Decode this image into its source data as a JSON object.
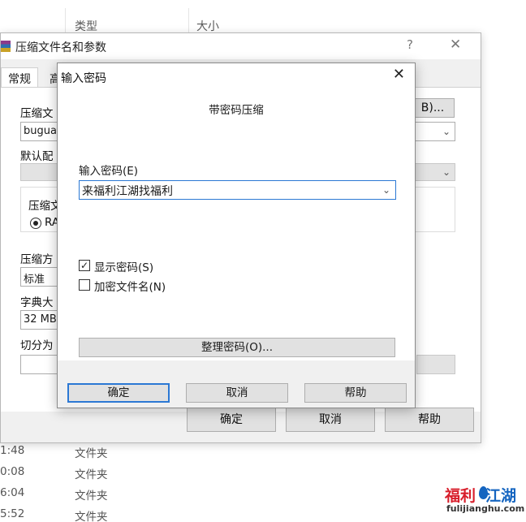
{
  "explorer": {
    "col_type": "类型",
    "col_size": "大小",
    "rows": [
      {
        "time": "1:48",
        "type": "文件夹"
      },
      {
        "time": "0:08",
        "type": "文件夹"
      },
      {
        "time": "6:04",
        "type": "文件夹"
      },
      {
        "time": "5:52",
        "type": "文件夹"
      }
    ]
  },
  "archive_dialog": {
    "title": "压缩文件名和参数",
    "help": "?",
    "close": "✕",
    "tab_general": "常规",
    "tab_advanced": "高",
    "label_archive_name": "压缩文",
    "browse_button": "B)...",
    "archive_name_value": "buguai",
    "label_default_profile": "默认配",
    "label_format": "压缩文",
    "format_rar": "RA",
    "label_method": "压缩方",
    "method_value": "标准",
    "label_dictionary": "字典大",
    "dictionary_value": "32 MB",
    "label_split": "切分为",
    "ok": "确定",
    "cancel": "取消",
    "help_button": "帮助"
  },
  "password_dialog": {
    "title": "输入密码",
    "close": "✕",
    "heading": "带密码压缩",
    "password_label": "输入密码(E)",
    "password_value": "来福利江湖找福利",
    "show_password_label": "显示密码(S)",
    "show_password_checked": true,
    "encrypt_names_label": "加密文件名(N)",
    "encrypt_names_checked": false,
    "organize_button": "整理密码(O)...",
    "ok": "确定",
    "cancel": "取消",
    "help": "帮助"
  },
  "watermark": {
    "brand_part1": "福利",
    "brand_part2": "江湖",
    "url": "fulijianghu.com"
  }
}
